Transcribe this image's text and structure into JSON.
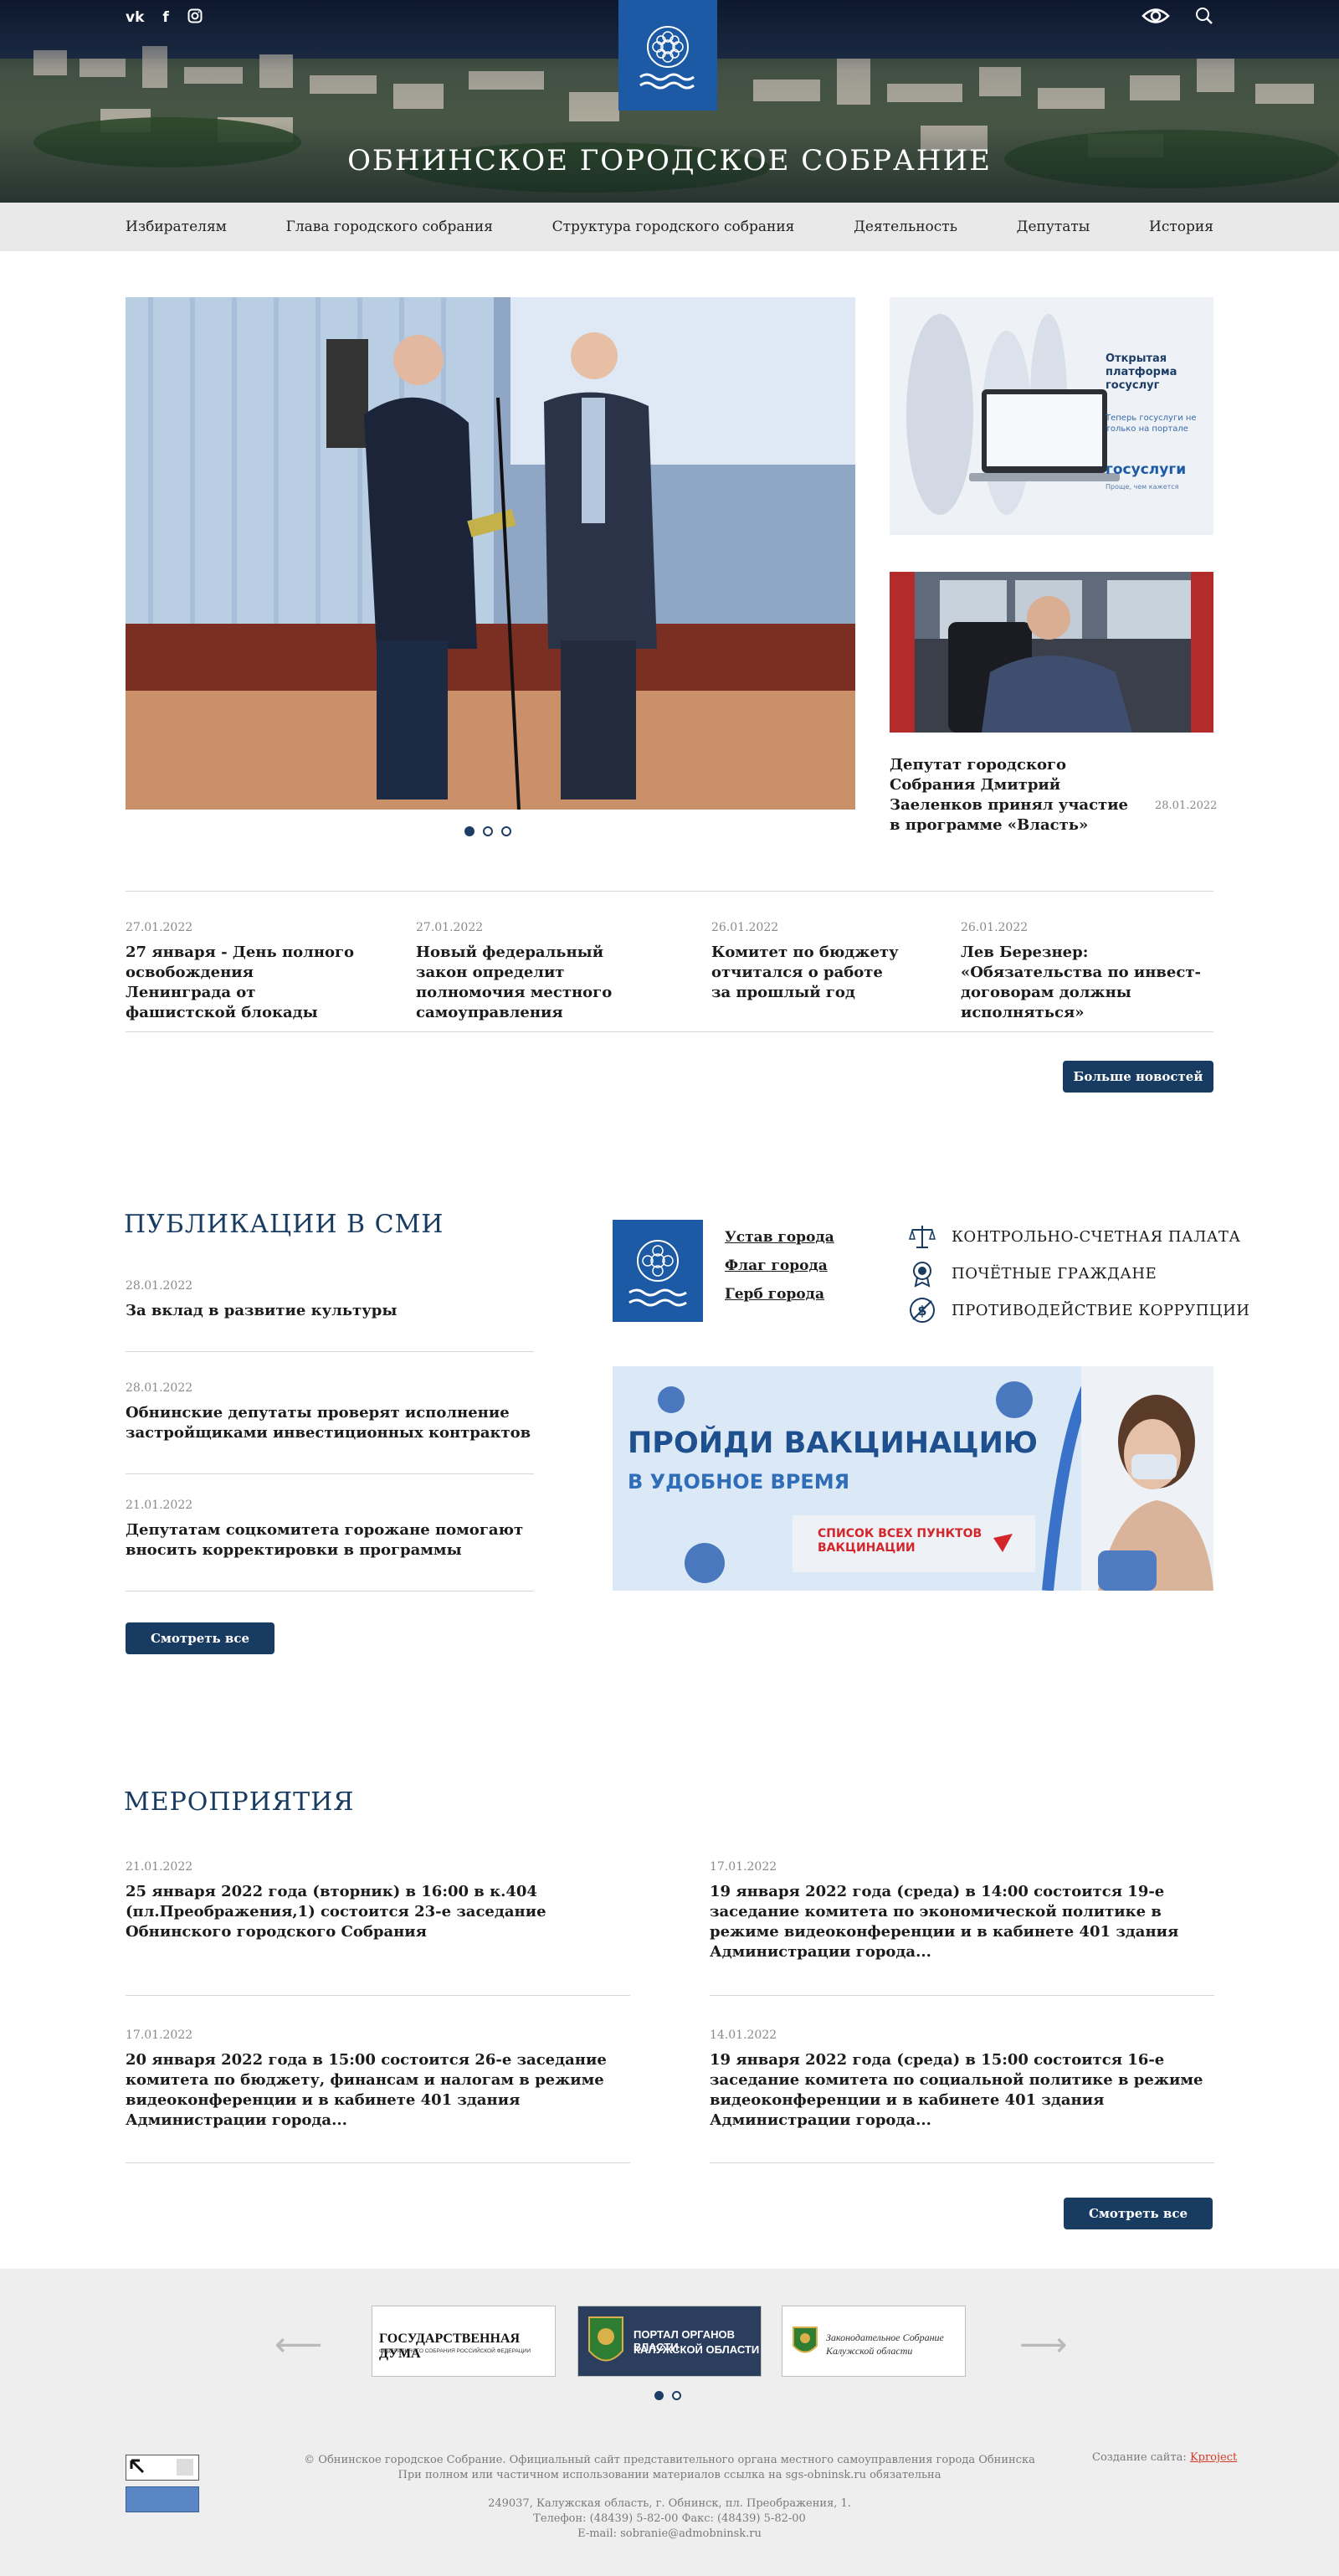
{
  "header": {
    "title": "ОБНИНСКОЕ ГОРОДСКОЕ СОБРАНИЕ",
    "social": [
      "vk",
      "f"
    ],
    "icons": [
      "vk-icon",
      "facebook-icon",
      "instagram-icon",
      "eye-icon",
      "search-icon"
    ]
  },
  "nav": {
    "items": [
      "Избирателям",
      "Глава городского собрания",
      "Структура городского собрания",
      "Деятельность",
      "Депутаты",
      "История"
    ]
  },
  "promo": {
    "gosuslugi_title": "Открытая платформа госуслуг",
    "gosuslugi_sub": "Теперь госуслуги не только на портале",
    "gosuslugi_logo": "госуслуги",
    "gosuslugi_slogan": "Проще, чем кажется",
    "news_title": "Депутат городского Собрания Дмитрий Заеленков принял участие в программе «Власть»",
    "news_date": "28.01.2022"
  },
  "news": [
    {
      "date": "27.01.2022",
      "title": "27 января - День полного освобождения Ленинграда от фашистской блокады"
    },
    {
      "date": "27.01.2022",
      "title": "Новый федеральный закон определит полномочия местного самоуправления"
    },
    {
      "date": "26.01.2022",
      "title": "Комитет по бюджету отчитался о работе за прошлый год"
    },
    {
      "date": "26.01.2022",
      "title": "Лев Березнер: «Обязательства по инвест-договорам должны исполняться»"
    }
  ],
  "more_news_label": "Больше новостей",
  "smi": {
    "heading": "ПУБЛИКАЦИИ В СМИ",
    "items": [
      {
        "date": "28.01.2022",
        "title": "За вклад в развитие культуры"
      },
      {
        "date": "28.01.2022",
        "title": "Обнинские депутаты проверят исполнение застройщиками инвестиционных контрактов"
      },
      {
        "date": "21.01.2022",
        "title": "Депутатам соцкомитета горожане помогают вносить корректировки в программы"
      }
    ],
    "button": "Смотреть все"
  },
  "city_links": [
    "Устав города",
    "Флаг города",
    "Герб города"
  ],
  "side_links": [
    "КОНТРОЛЬНО-СЧЕТНАЯ ПАЛАТА",
    "ПОЧЁТНЫЕ ГРАЖДАНЕ",
    "ПРОТИВОДЕЙСТВИЕ КОРРУПЦИИ"
  ],
  "vaccine": {
    "title": "ПРОЙДИ ВАКЦИНАЦИЮ",
    "subtitle": "В УДОБНОЕ ВРЕМЯ",
    "button": "СПИСОК ВСЕХ ПУНКТОВ ВАКЦИНАЦИИ"
  },
  "events": {
    "heading": "МЕРОПРИЯТИЯ",
    "items": [
      {
        "date": "21.01.2022",
        "title": "25 января 2022 года (вторник) в 16:00 в к.404 (пл.Преображения,1) состоится 23-е заседание Обнинского городского Собрания"
      },
      {
        "date": "17.01.2022",
        "title": "19 января 2022 года (среда) в 14:00 состоится 19-е заседание комитета по экономической политике в режиме видеоконференции и в кабинете 401 здания Администрации города..."
      },
      {
        "date": "17.01.2022",
        "title": "20 января 2022 года в 15:00 состоится 26-е заседание комитета по бюджету, финансам и налогам в режиме видеоконференции и в кабинете 401 здания Администрации города..."
      },
      {
        "date": "14.01.2022",
        "title": "19 января 2022 года (среда) в 15:00 состоится 16-е заседание комитета по социальной политике в режиме видеоконференции и в кабинете 401 здания Администрации города..."
      }
    ],
    "button": "Смотреть все"
  },
  "partners": [
    {
      "line1": "ГОСУДАРСТВЕННАЯ ДУМА",
      "line2": "ФЕДЕРАЛЬНОГО СОБРАНИЯ РОССИЙСКОЙ ФЕДЕРАЦИИ"
    },
    {
      "line1": "ПОРТАЛ ОРГАНОВ ВЛАСТИ",
      "line2": "КАЛУЖСКОЙ ОБЛАСТИ"
    },
    {
      "line1": "Законодательное Собрание",
      "line2": "Калужской области"
    }
  ],
  "footer": {
    "copy1": "© Обнинское городское Собрание. Официальный сайт представительного органа местного самоуправления города Обнинска",
    "copy2": "При полном или частичном использовании материалов ссылка на sgs-obninsk.ru обязательна",
    "address": "249037, Калужская область, г. Обнинск, пл. Преображения, 1.",
    "phone": "Телефон: (48439) 5-82-00   Факс: (48439) 5-82-00",
    "email": "E-mail: sobranie@admobninsk.ru",
    "maker_prefix": "Создание сайта: ",
    "maker_name": "Kproject"
  },
  "colors": {
    "brand": "#183b62",
    "emblem": "#1d5aa6",
    "nav_bg": "#e9e9e9",
    "footer_bg": "#eeeeee"
  }
}
